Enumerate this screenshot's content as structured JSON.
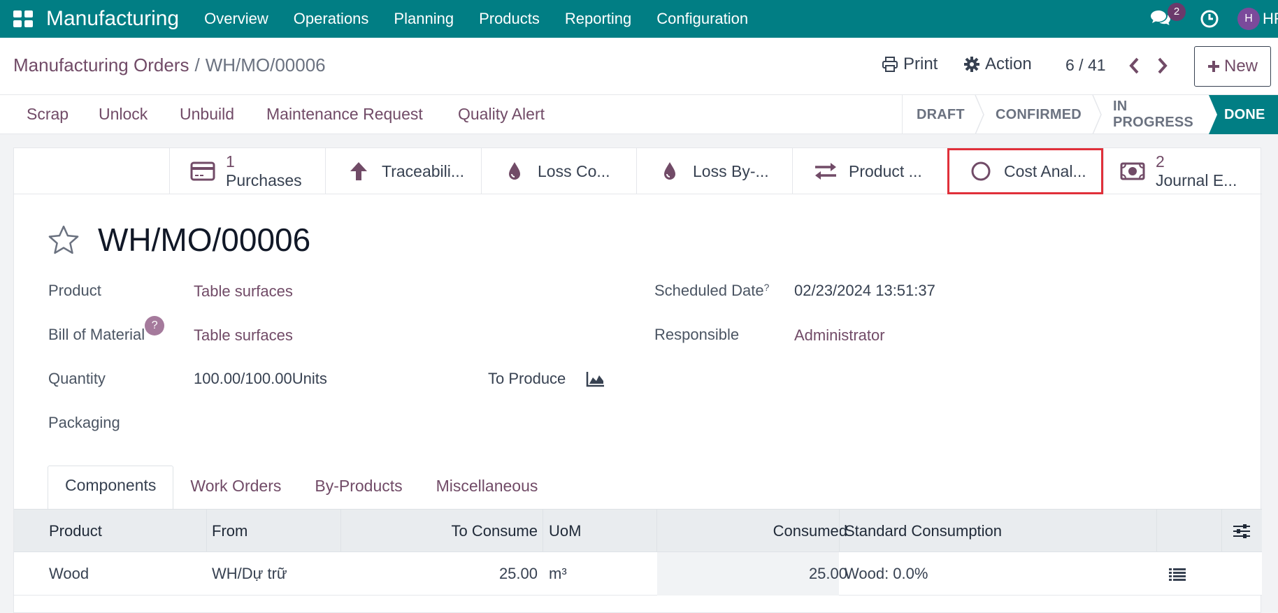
{
  "navbar": {
    "app_name": "Manufacturing",
    "menu": [
      "Overview",
      "Operations",
      "Planning",
      "Products",
      "Reporting",
      "Configuration"
    ],
    "chat_badge": "2",
    "avatar_initial": "H",
    "user_label": "HR"
  },
  "control": {
    "breadcrumb_parent": "Manufacturing Orders",
    "breadcrumb_separator": "/",
    "breadcrumb_current": "WH/MO/00006",
    "print_label": "Print",
    "action_label": "Action",
    "pager": "6 / 41",
    "new_label": "New"
  },
  "actions": [
    "Scrap",
    "Unlock",
    "Unbuild",
    "Maintenance Request",
    "Quality Alert"
  ],
  "statusbar": {
    "stages": [
      "DRAFT",
      "CONFIRMED",
      "IN PROGRESS",
      "DONE"
    ],
    "current": "DONE"
  },
  "smart_buttons": {
    "purchases_count": "1",
    "purchases_label": "Purchases",
    "traceability": "Traceabili...",
    "loss_components": "Loss Co...",
    "loss_byproducts": "Loss By-...",
    "product_moves": "Product ...",
    "cost_analysis": "Cost Anal...",
    "journal_count": "2",
    "journal_label": "Journal E..."
  },
  "record": {
    "name": "WH/MO/00006",
    "product_label": "Product",
    "product_value": "Table surfaces",
    "bom_label": "Bill of Material",
    "bom_help": "?",
    "bom_value": "Table surfaces",
    "quantity_label": "Quantity",
    "quantity_value": "100.00/100.00Units",
    "to_produce_label": "To Produce",
    "packaging_label": "Packaging",
    "scheduled_label": "Scheduled Date",
    "scheduled_help": "?",
    "scheduled_value": "02/23/2024 13:51:37",
    "responsible_label": "Responsible",
    "responsible_value": "Administrator"
  },
  "tabs": [
    "Components",
    "Work Orders",
    "By-Products",
    "Miscellaneous"
  ],
  "active_tab": "Components",
  "components": {
    "columns": [
      "Product",
      "From",
      "To Consume",
      "UoM",
      "Consumed",
      "Standard Consumption"
    ],
    "rows": [
      {
        "product": "Wood",
        "from": "WH/Dự trữ",
        "to_consume": "25.00",
        "uom": "m³",
        "consumed": "25.00",
        "standard": "Wood: 0.0%"
      }
    ]
  },
  "colors": {
    "navbar": "#017e84",
    "link": "#714b67",
    "highlight": "#e0303a",
    "done_stage": "#017e84"
  },
  "icons": {
    "apps": "apps-grid-icon",
    "chat": "chat-icon",
    "activity": "clock-icon",
    "print": "print-icon",
    "action": "gear-icon",
    "prev": "chevron-left-icon",
    "next": "chevron-right-icon",
    "new": "plus-icon",
    "purchases": "credit-card-icon",
    "traceability": "arrow-up-icon",
    "loss": "drop-icon",
    "product_moves": "exchange-icon",
    "cost": "circle-icon",
    "journal": "money-icon",
    "favorite": "star-icon",
    "forecast": "area-chart-icon",
    "settings": "sliders-icon",
    "details": "list-icon"
  }
}
